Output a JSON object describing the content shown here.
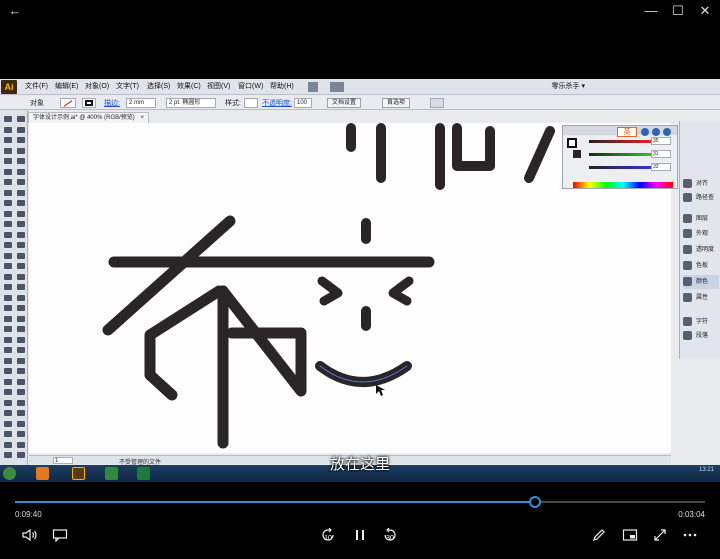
{
  "window": {
    "back_glyph": "←",
    "minimize_glyph": "—",
    "maximize_glyph": "☐",
    "close_glyph": "✕"
  },
  "illustrator": {
    "logo": "Ai",
    "menu": [
      "文件(F)",
      "编辑(E)",
      "对象(O)",
      "文字(T)",
      "选择(S)",
      "效果(C)",
      "视图(V)",
      "窗口(W)",
      "帮助(H)"
    ],
    "workspace": "零乐杀手 ▾",
    "control_bar": {
      "object_label": "对象",
      "stroke_label": "描边:",
      "stroke_value": "2 mm",
      "brush_value": "2 pt. 椭圆形",
      "style_label": "样式:",
      "opacity_label": "不透明度:",
      "opacity_value": "100",
      "doc_setup_button": "文档设置",
      "preferences_button": "首选项"
    },
    "doc_tab": "字体设计示例.ai* @ 400% (RGB/预览)",
    "status": {
      "zoom": "1",
      "message": "不受管理的文件"
    },
    "color_panel": {
      "r_value": "35",
      "g_value": "31",
      "b_value": "32",
      "ime_label": "英"
    },
    "panels": [
      {
        "label": "对齐",
        "icon": "align-icon"
      },
      {
        "label": "路径查",
        "icon": "pathfinder-icon"
      },
      {
        "label": "图层",
        "icon": "layers-icon"
      },
      {
        "label": "外观",
        "icon": "appearance-icon"
      },
      {
        "label": "透明度",
        "icon": "transparency-icon"
      },
      {
        "label": "色板",
        "icon": "swatches-icon"
      },
      {
        "label": "颜色",
        "icon": "color-icon"
      },
      {
        "label": "属性",
        "icon": "attributes-icon"
      },
      {
        "label": "字符",
        "icon": "character-icon"
      },
      {
        "label": "段落",
        "icon": "paragraph-icon"
      }
    ],
    "taskbar_time": "13:21"
  },
  "subtitle": "放在这里",
  "player": {
    "current_time": "0:09:40",
    "total_time": "0:03:04",
    "progress": 0.753,
    "rewind_seconds": "10",
    "forward_seconds": "30",
    "accent": "#2f8fd8"
  }
}
